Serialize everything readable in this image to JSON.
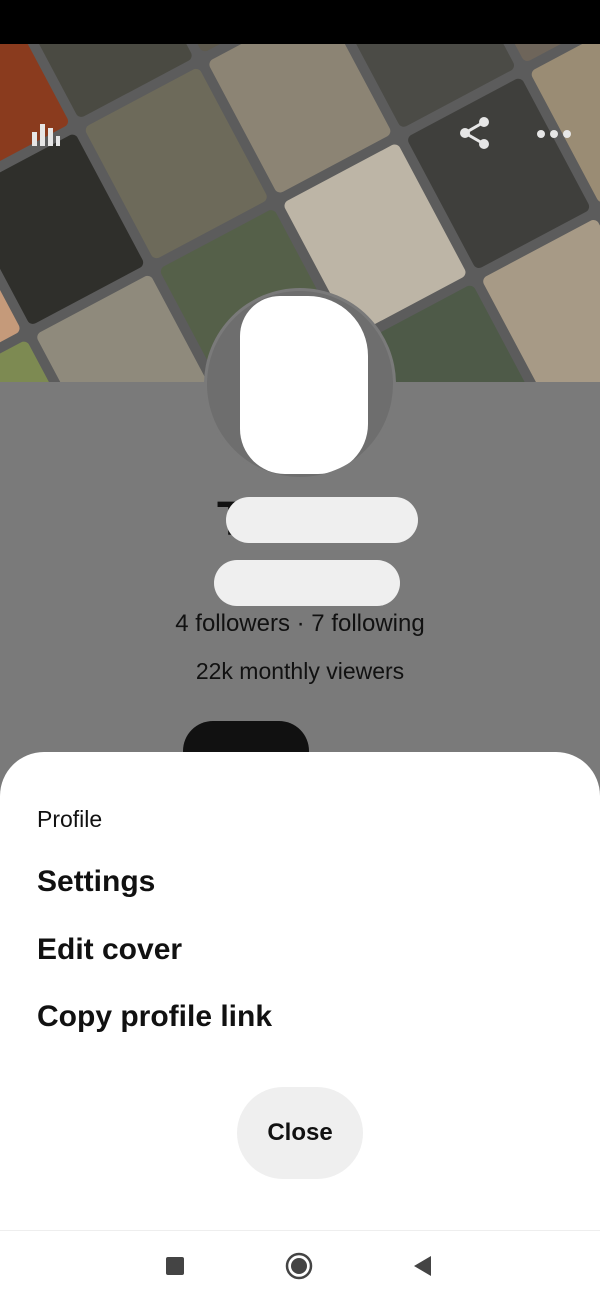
{
  "profile": {
    "name_visible_prefix": "T",
    "stats": "4 followers · 7 following",
    "monthly_viewers": "22k monthly viewers"
  },
  "cover": {
    "tile_colors": [
      "#6b5a45",
      "#8a3b1e",
      "#4a4a42",
      "#5e5a4e",
      "#a0a0a0",
      "#7a7468",
      "#c59a7a",
      "#2f2f2b",
      "#6d6a5a",
      "#8c8474",
      "#4b4b46",
      "#6e655a",
      "#7d8a52",
      "#8f8a7c",
      "#556049",
      "#bdb5a6",
      "#3f3f3c",
      "#9a8c74",
      "#b58a4e",
      "#6b6b66",
      "#8e8e88",
      "#4e5a48",
      "#a79a86",
      "#585852",
      "#5a5a55",
      "#7f7865",
      "#c2b8a2",
      "#66705c",
      "#8b8b84",
      "#4a4a46"
    ]
  },
  "sheet": {
    "title": "Profile",
    "items": [
      "Settings",
      "Edit cover",
      "Copy profile link"
    ],
    "close_label": "Close"
  },
  "icons": {
    "stats": "bar-chart-icon",
    "share": "share-icon",
    "more": "more-dots-icon",
    "nav_recent": "square-recents-icon",
    "nav_home": "circle-home-icon",
    "nav_back": "triangle-back-icon"
  }
}
